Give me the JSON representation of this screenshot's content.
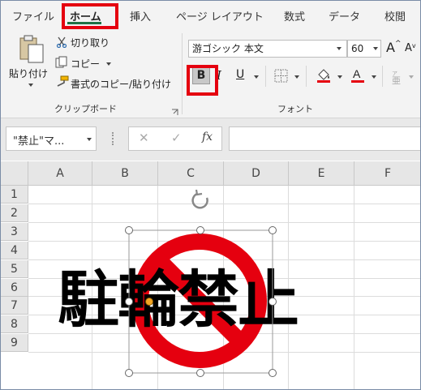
{
  "tabs": [
    "ファイル",
    "ホーム",
    "挿入",
    "ページ レイアウト",
    "数式",
    "データ",
    "校閲"
  ],
  "clipboard": {
    "paste_label": "貼り付け",
    "cut_label": "切り取り",
    "copy_label": "コピー",
    "format_painter_label": "書式のコピー/貼り付け",
    "group_label": "クリップボード"
  },
  "font": {
    "name": "游ゴシック 本文",
    "size": "60",
    "grow_label": "A",
    "shrink_label": "A",
    "bold_label": "B",
    "italic_label": "I",
    "underline_label": "U",
    "group_label": "フォント",
    "highlight_color": "#ffff00",
    "font_color": "#e5000f"
  },
  "formula_bar": {
    "name_box": "\"禁止\"マ...",
    "cancel_label": "✕",
    "enter_label": "✓",
    "fx_label": "fx"
  },
  "columns": [
    "A",
    "B",
    "C",
    "D",
    "E",
    "F"
  ],
  "rows": [
    "1",
    "2",
    "3",
    "4",
    "5",
    "6",
    "7",
    "8",
    "9"
  ],
  "sheet_text": "駐輪禁止",
  "colors": {
    "highlight_box": "#e5000f",
    "prohibition_sign": "#e5000f",
    "active_tab_underline": "#1e7145"
  }
}
